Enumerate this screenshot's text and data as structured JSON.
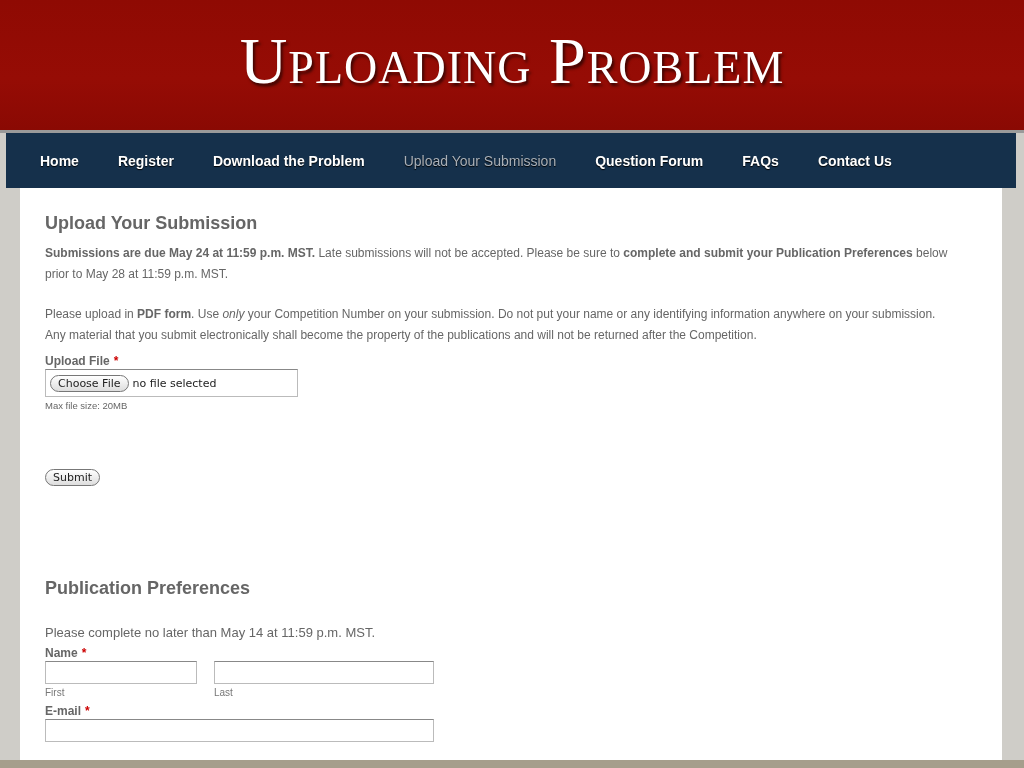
{
  "slide": {
    "title": "Uploading Problem"
  },
  "nav": {
    "items": [
      {
        "label": "Home",
        "selected": false
      },
      {
        "label": "Register",
        "selected": false
      },
      {
        "label": "Download the Problem",
        "selected": false
      },
      {
        "label": "Upload Your Submission",
        "selected": true
      },
      {
        "label": "Question Forum",
        "selected": false
      },
      {
        "label": "FAQs",
        "selected": false
      },
      {
        "label": "Contact Us",
        "selected": false
      }
    ]
  },
  "upload_section": {
    "heading": "Upload Your Submission",
    "paragraphs": [
      "**Submissions are due May 24 at 11:59 p.m. MST.** Late submissions will not be accepted. Please be sure to **complete and submit your Publication Preferences** below prior to May 28 at 11:59 p.m. MST.",
      "Please upload in **PDF form**. Use *only* your Competition Number on your submission. Do not put your name or any identifying information anywhere on your submission. Any material that you submit electronically shall become the property of the publications and will not be returned after the Competition."
    ],
    "file_field": {
      "label": "Upload File",
      "required_mark": "*",
      "button": "Choose File",
      "value": "no file selected",
      "hint": "Max file size: 20MB"
    },
    "submit": "Submit"
  },
  "preferences": {
    "heading": "Publication Preferences",
    "note": "Please complete no later than May 14 at 11:59 p.m. MST.",
    "name_field": {
      "label": "Name",
      "required_mark": "*",
      "parts": [
        {
          "caption": "First"
        },
        {
          "caption": "Last"
        }
      ]
    },
    "email_field": {
      "label": "E-mail",
      "required_mark": "*"
    }
  }
}
